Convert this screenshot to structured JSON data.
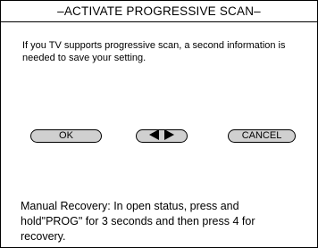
{
  "dialog": {
    "title": "–ACTIVATE PROGRESSIVE SCAN–",
    "notice": "If you TV supports progressive scan, a second information is needed to save your setting.",
    "buttons": {
      "ok_label": "OK",
      "left_arrow_icon": "triangle-left-icon",
      "right_arrow_icon": "triangle-right-icon",
      "cancel_label": "CANCEL"
    },
    "recovery_note": "Manual Recovery: In open status, press and hold\"PROG\" for 3 seconds and then press 4 for recovery."
  },
  "colors": {
    "background": "#ffffff",
    "border": "#000000",
    "button_fill": "#d0d0d0",
    "text": "#000000"
  }
}
